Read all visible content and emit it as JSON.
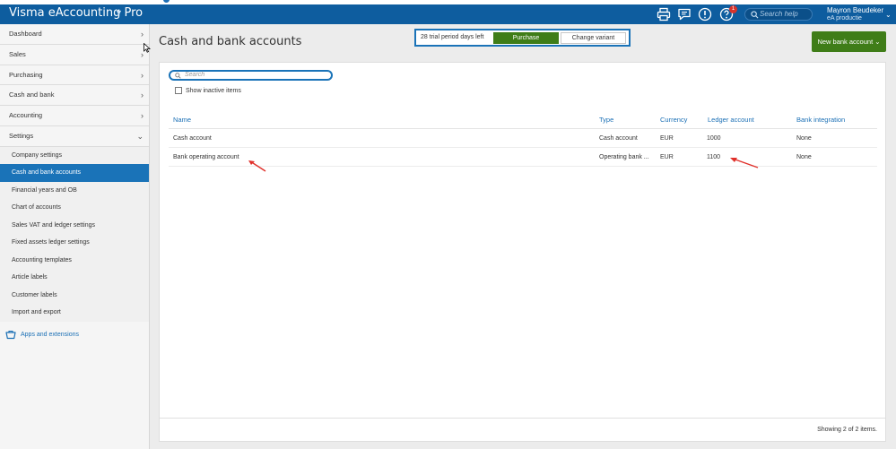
{
  "header": {
    "app_title": "Visma eAccounting Pro",
    "search_placeholder": "Search help",
    "user_name": "Mayron Beudeker",
    "user_org": "eA productie",
    "help_badge_count": "1"
  },
  "sidebar": {
    "items": [
      {
        "label": "Dashboard"
      },
      {
        "label": "Sales"
      },
      {
        "label": "Purchasing"
      },
      {
        "label": "Cash and bank"
      },
      {
        "label": "Accounting"
      },
      {
        "label": "Settings"
      }
    ],
    "settings_sub": [
      {
        "label": "Company settings"
      },
      {
        "label": "Cash and bank accounts"
      },
      {
        "label": "Financial years and OB"
      },
      {
        "label": "Chart of accounts"
      },
      {
        "label": "Sales VAT and ledger settings"
      },
      {
        "label": "Fixed assets ledger settings"
      },
      {
        "label": "Accounting templates"
      },
      {
        "label": "Article labels"
      },
      {
        "label": "Customer labels"
      },
      {
        "label": "Import and export"
      }
    ],
    "apps_link": "Apps and extensions"
  },
  "page": {
    "title": "Cash and bank accounts",
    "trial_text": "28 trial period days left",
    "purchase_label": "Purchase",
    "change_variant_label": "Change variant",
    "new_bank_account_label": "New bank account"
  },
  "list": {
    "search_placeholder": "Search",
    "show_inactive_label": "Show inactive items",
    "columns": [
      "Name",
      "Type",
      "Currency",
      "Ledger account",
      "Bank integration"
    ],
    "rows": [
      {
        "name": "Cash account",
        "type": "Cash account",
        "currency": "EUR",
        "ledger": "1000",
        "integration": "None"
      },
      {
        "name": "Bank operating account",
        "type": "Operating bank ...",
        "currency": "EUR",
        "ledger": "1100",
        "integration": "None"
      }
    ],
    "footer": "Showing 2 of 2 items."
  },
  "colors": {
    "topbar": "#0e5d9f",
    "accent": "#1a73b8",
    "primary_button": "#3f7d18",
    "annotation_arrow": "#e0302a"
  }
}
